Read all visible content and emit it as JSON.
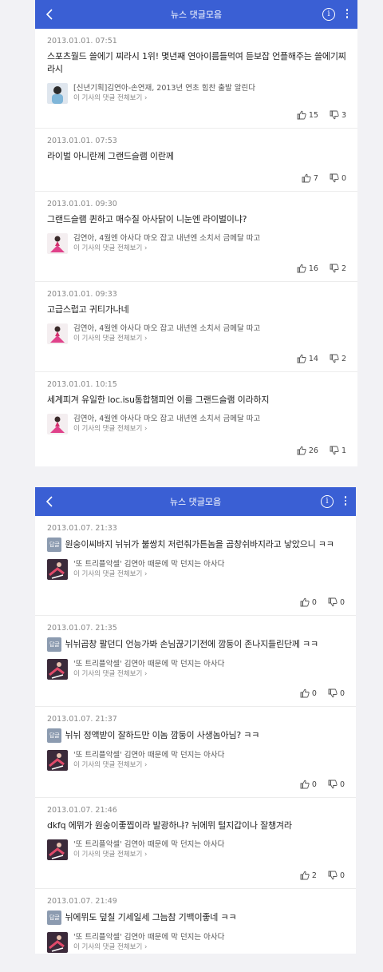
{
  "panel1": {
    "header_title": "뉴스 댓글모음",
    "comments": [
      {
        "date": "2013.01.01. 07:51",
        "text": "스포츠월드 쓸에기 찌라시 1위! 몇년째 연아이름들먹여 듣보잡 언플해주는 쓸에기찌라시",
        "article_title": "[신년기획]김연아-손연재, 2013년 연초 힘찬 출발 알린다",
        "article_link": "이 기사의 댓글 전체보기",
        "likes": "15",
        "dislikes": "3"
      },
      {
        "date": "2013.01.01. 07:53",
        "text": "라이벌 아니란께 그랜드슬램 이란께",
        "likes": "7",
        "dislikes": "0"
      },
      {
        "date": "2013.01.01. 09:30",
        "text": "그랜드슬램 퀸하고 매수질 아사닭이 니눈엔 라이벌이냐?",
        "article_title": "김연아, 4월엔 아사다 마오 잡고 내년엔 소치서 금메달 따고",
        "article_link": "이 기사의 댓글 전체보기",
        "likes": "16",
        "dislikes": "2"
      },
      {
        "date": "2013.01.01. 09:33",
        "text": "고급스럽고 귀티가나네",
        "article_title": "김연아, 4월엔 아사다 마오 잡고 내년엔 소치서 금메달 따고",
        "article_link": "이 기사의 댓글 전체보기",
        "likes": "14",
        "dislikes": "2"
      },
      {
        "date": "2013.01.01. 10:15",
        "text": "세계피겨 유일한 loc.isu통합챔피언 이를 그랜드슬램 이라하지",
        "article_title": "김연아, 4월엔 아사다 마오 잡고 내년엔 소치서 금메달 따고",
        "article_link": "이 기사의 댓글 전체보기",
        "likes": "26",
        "dislikes": "1"
      }
    ]
  },
  "panel2": {
    "header_title": "뉴스 댓글모음",
    "reply_badge": "답글",
    "comments": [
      {
        "date": "2013.01.07. 21:33",
        "text": "원숭이씨바지 뉘뉘가 불쌍치 저런줘가튼놈을 곱창쉬바지라고 낳았으니 ㅋㅋ",
        "article_title": "'또 트리플악셀' 김연아 때문에 막 던지는 아사다",
        "article_link": "이 기사의 댓글 전체보기",
        "likes": "0",
        "dislikes": "0"
      },
      {
        "date": "2013.01.07. 21:35",
        "text": "뉘뉘곱창 팔던디 언능가봐 손님끊기기전에 깜둥이 존나지들린단께 ㅋㅋ",
        "article_title": "'또 트리플악셀' 김연아 때문에 막 던지는 아사다",
        "article_link": "이 기사의 댓글 전체보기",
        "likes": "0",
        "dislikes": "0"
      },
      {
        "date": "2013.01.07. 21:37",
        "text": "뉘뉘 정액받이 잘하드만 이놈 깜둥이 사생놈아님? ㅋㅋ",
        "article_title": "'또 트리플악셀' 김연아 때문에 막 던지는 아사다",
        "article_link": "이 기사의 댓글 전체보기",
        "likes": "0",
        "dislikes": "0"
      },
      {
        "date": "2013.01.07. 21:46",
        "text": "dkfq 에뮈가 원숭이좋찝이라 발광하냐? 뉘에뮈 털지갑이나 잘챙겨라",
        "article_title": "'또 트리플악셀' 김연아 때문에 막 던지는 아사다",
        "article_link": "이 기사의 댓글 전체보기",
        "likes": "2",
        "dislikes": "0"
      },
      {
        "date": "2013.01.07. 21:49",
        "text": "뉘에뮈도 덮칠 기세일세 그늠참 기백이좋네 ㅋㅋ",
        "article_title": "'또 트리플악셀' 김연아 때문에 막 던지는 아사다",
        "article_link": "이 기사의 댓글 전체보기",
        "likes": "",
        "dislikes": ""
      }
    ]
  },
  "colors": {
    "appbar": "#3a5fd4",
    "badge": "#8c9bb0"
  }
}
